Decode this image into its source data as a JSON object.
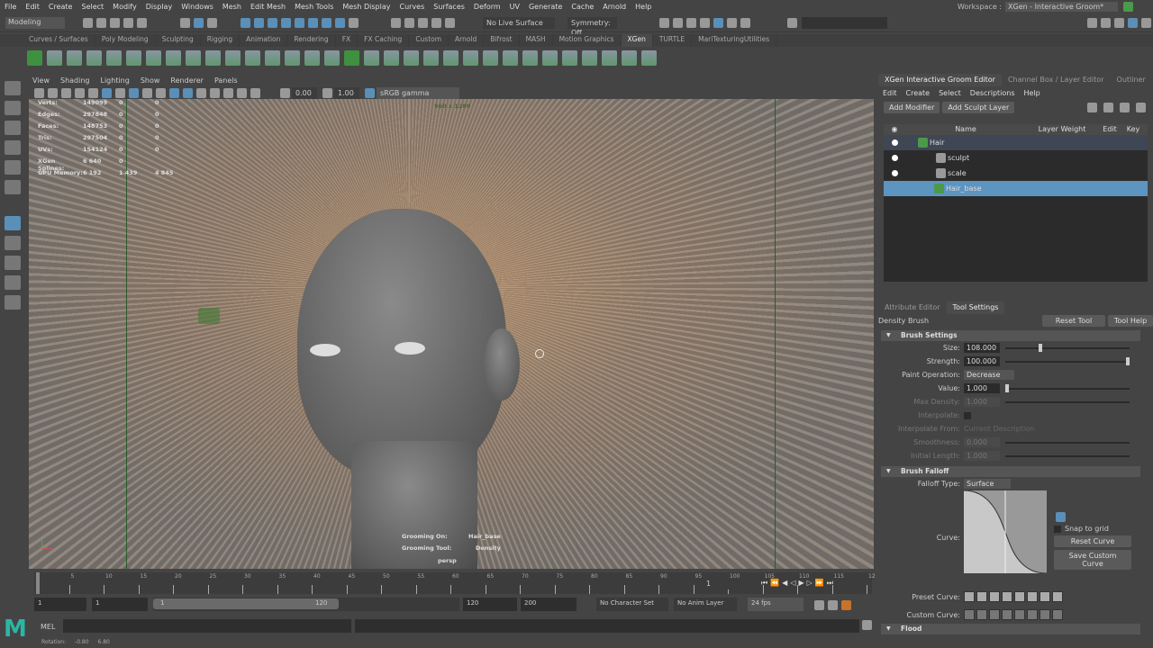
{
  "menubar": [
    "File",
    "Edit",
    "Create",
    "Select",
    "Modify",
    "Display",
    "Windows",
    "Mesh",
    "Edit Mesh",
    "Mesh Tools",
    "Mesh Display",
    "Curves",
    "Surfaces",
    "Deform",
    "UV",
    "Generate",
    "Cache",
    "Arnold",
    "Help"
  ],
  "workspace": {
    "label": "Workspace :",
    "value": "XGen - Interactive Groom*"
  },
  "status": {
    "mode": "Modeling",
    "live_surface": "No Live Surface",
    "symmetry": "Symmetry: Off"
  },
  "shelf_tabs": [
    "Curves / Surfaces",
    "Poly Modeling",
    "Sculpting",
    "Rigging",
    "Animation",
    "Rendering",
    "FX",
    "FX Caching",
    "Custom",
    "Arnold",
    "Bifrost",
    "MASH",
    "Motion Graphics",
    "XGen",
    "TURTLE",
    "MariTexturingUtilities"
  ],
  "active_shelf": "XGen",
  "viewport": {
    "menu": [
      "View",
      "Shading",
      "Lighting",
      "Show",
      "Renderer",
      "Panels"
    ],
    "exposure": "0.00",
    "gamma": "1.00",
    "color_space": "sRGB gamma",
    "resolution": "960 x 1280",
    "stats": [
      [
        "Verts:",
        "149099",
        "0",
        "0"
      ],
      [
        "Edges:",
        "297848",
        "0",
        "0"
      ],
      [
        "Faces:",
        "148753",
        "0",
        "0"
      ],
      [
        "Tris:",
        "297504",
        "0",
        "0"
      ],
      [
        "UVs:",
        "154124",
        "0",
        "0"
      ]
    ],
    "xgen_splines": [
      "XGen Splines:",
      "6 640",
      "0"
    ],
    "gpu_memory": [
      "GPU Memory:",
      "6 192",
      "1 439",
      "4 845"
    ],
    "grooming_on_label": "Grooming On:",
    "grooming_on": "Hair_base",
    "grooming_tool_label": "Grooming Tool:",
    "grooming_tool": "Density",
    "camera": "persp"
  },
  "groom_editor": {
    "tabs": [
      "XGen Interactive Groom Editor",
      "Channel Box / Layer Editor",
      "Outliner"
    ],
    "menu": [
      "Edit",
      "Create",
      "Select",
      "Descriptions",
      "Help"
    ],
    "add_modifier": "Add Modifier",
    "add_sculpt_layer": "Add Sculpt Layer",
    "columns": [
      "Name",
      "Layer Weight",
      "Edit",
      "Key"
    ],
    "rows": [
      "Hair",
      "sculpt",
      "scale",
      "Hair_base"
    ]
  },
  "tool_settings": {
    "tabs": [
      "Attribute Editor",
      "Tool Settings"
    ],
    "tool_name": "Density Brush",
    "reset_tool": "Reset Tool",
    "tool_help": "Tool Help",
    "brush_settings": "Brush Settings",
    "size_label": "Size:",
    "size": "108.000",
    "size_pct": 0.27,
    "strength_label": "Strength:",
    "strength": "100.000",
    "strength_pct": 1.0,
    "paint_op_label": "Paint Operation:",
    "paint_op": "Decrease",
    "value_label": "Value:",
    "value": "1.000",
    "max_density_label": "Max Density:",
    "max_density": "1.000",
    "interpolate_label": "Interpolate:",
    "interp_from_label": "Interpolate From:",
    "interp_from": "Current Description",
    "smoothness_label": "Smoothness:",
    "smoothness": "0.000",
    "initial_length_label": "Initial Length:",
    "initial_length": "1.000",
    "brush_falloff": "Brush Falloff",
    "falloff_type_label": "Falloff Type:",
    "falloff_type": "Surface",
    "curve_label": "Curve:",
    "snap_to_grid": "Snap to grid",
    "reset_curve": "Reset Curve",
    "save_custom_curve": "Save Custom Curve",
    "preset_curve_label": "Preset Curve:",
    "custom_curve_label": "Custom Curve:",
    "flood": "Flood"
  },
  "timeline": {
    "ticks": [
      "5",
      "10",
      "15",
      "20",
      "25",
      "30",
      "35",
      "40",
      "45",
      "50",
      "55",
      "60",
      "65",
      "70",
      "75",
      "80",
      "85",
      "90",
      "95",
      "100",
      "105",
      "110",
      "115",
      "12"
    ],
    "current_frame": "1"
  },
  "range": {
    "start": "1",
    "playback_start": "1",
    "slider_start": "1",
    "slider_end": "120",
    "playback_end": "120",
    "end": "200",
    "character_set": "No Character Set",
    "anim_layer": "No Anim Layer",
    "fps": "24 fps"
  },
  "command": {
    "label": "MEL"
  },
  "help_line": {
    "label": "Rotation:",
    "x": "-0.80",
    "y": "6.80"
  }
}
